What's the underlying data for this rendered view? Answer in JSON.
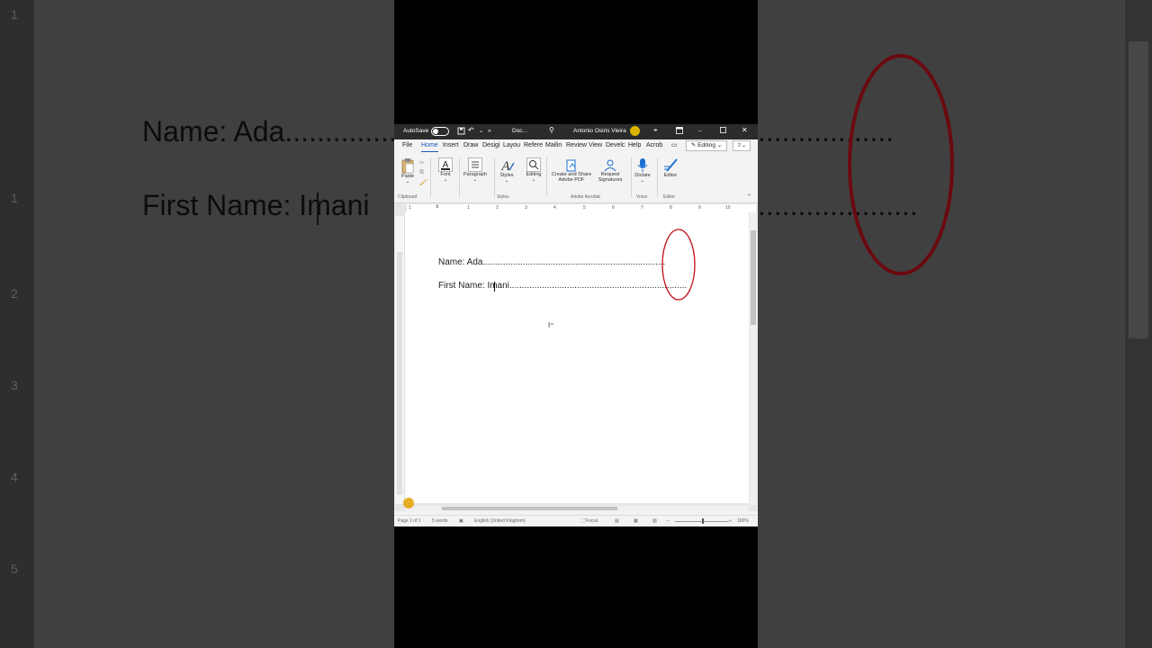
{
  "background": {
    "name_line": "Name: Ada..............",
    "first_name_line": "First Name: Imani",
    "dots": "..............................",
    "ruler_numbers": [
      "1",
      "1",
      "2",
      "3",
      "4",
      "5"
    ]
  },
  "titlebar": {
    "autosave": "AutoSave",
    "autosave_state": "Off",
    "doc_title": "Doc...",
    "user": "Antonio Osiris Vieira"
  },
  "menu": {
    "tabs": [
      "File",
      "Home",
      "Insert",
      "Draw",
      "Design",
      "Layout",
      "References",
      "Mailings",
      "Review",
      "View",
      "Developer",
      "Help",
      "Acrobat"
    ],
    "tabs_display": [
      "File",
      "Home",
      "Insert",
      "Draw",
      "Desigi",
      "Layou",
      "Refere",
      "Mailin",
      "Review",
      "View",
      "Develc",
      "Help",
      "Acrob"
    ],
    "editing_mode": "Editing"
  },
  "ribbon": {
    "paste": "Paste",
    "font": "Font",
    "paragraph": "Paragraph",
    "styles": "Styles",
    "editing": "Editing",
    "create_share": "Create and Share",
    "adobe_pdf": "Adobe PDF",
    "request": "Request",
    "signatures": "Signatures",
    "dictate": "Dictate",
    "editor": "Editor",
    "groups": {
      "clipboard": "Clipboard",
      "styles": "Styles",
      "adobe_acrobat": "Adobe Acrobat",
      "voice": "Voice",
      "editor": "Editor"
    }
  },
  "document": {
    "line1": "Name: Ada.........................................................................",
    "line2": "First Name: Imani.......................................................................",
    "ruler_marks": [
      "1",
      "1",
      "2",
      "3",
      "4",
      "5",
      "6",
      "7",
      "8",
      "9",
      "10"
    ]
  },
  "status": {
    "page": "Page 1 of 1",
    "words": "5 words",
    "language": "English (United Kingdom)",
    "focus": "Focus",
    "zoom": "160%"
  },
  "colors": {
    "annotation_circle": "#c0101a",
    "accent": "#185abd",
    "titlebar": "#2b2b2b"
  }
}
